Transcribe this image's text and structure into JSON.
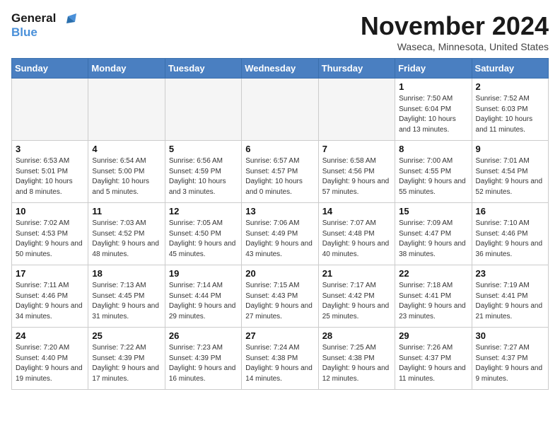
{
  "header": {
    "logo_line1": "General",
    "logo_line2": "Blue",
    "month": "November 2024",
    "location": "Waseca, Minnesota, United States"
  },
  "weekdays": [
    "Sunday",
    "Monday",
    "Tuesday",
    "Wednesday",
    "Thursday",
    "Friday",
    "Saturday"
  ],
  "weeks": [
    [
      {
        "day": "",
        "sunrise": "",
        "sunset": "",
        "daylight": ""
      },
      {
        "day": "",
        "sunrise": "",
        "sunset": "",
        "daylight": ""
      },
      {
        "day": "",
        "sunrise": "",
        "sunset": "",
        "daylight": ""
      },
      {
        "day": "",
        "sunrise": "",
        "sunset": "",
        "daylight": ""
      },
      {
        "day": "",
        "sunrise": "",
        "sunset": "",
        "daylight": ""
      },
      {
        "day": "1",
        "sunrise": "Sunrise: 7:50 AM",
        "sunset": "Sunset: 6:04 PM",
        "daylight": "Daylight: 10 hours and 13 minutes."
      },
      {
        "day": "2",
        "sunrise": "Sunrise: 7:52 AM",
        "sunset": "Sunset: 6:03 PM",
        "daylight": "Daylight: 10 hours and 11 minutes."
      }
    ],
    [
      {
        "day": "3",
        "sunrise": "Sunrise: 6:53 AM",
        "sunset": "Sunset: 5:01 PM",
        "daylight": "Daylight: 10 hours and 8 minutes."
      },
      {
        "day": "4",
        "sunrise": "Sunrise: 6:54 AM",
        "sunset": "Sunset: 5:00 PM",
        "daylight": "Daylight: 10 hours and 5 minutes."
      },
      {
        "day": "5",
        "sunrise": "Sunrise: 6:56 AM",
        "sunset": "Sunset: 4:59 PM",
        "daylight": "Daylight: 10 hours and 3 minutes."
      },
      {
        "day": "6",
        "sunrise": "Sunrise: 6:57 AM",
        "sunset": "Sunset: 4:57 PM",
        "daylight": "Daylight: 10 hours and 0 minutes."
      },
      {
        "day": "7",
        "sunrise": "Sunrise: 6:58 AM",
        "sunset": "Sunset: 4:56 PM",
        "daylight": "Daylight: 9 hours and 57 minutes."
      },
      {
        "day": "8",
        "sunrise": "Sunrise: 7:00 AM",
        "sunset": "Sunset: 4:55 PM",
        "daylight": "Daylight: 9 hours and 55 minutes."
      },
      {
        "day": "9",
        "sunrise": "Sunrise: 7:01 AM",
        "sunset": "Sunset: 4:54 PM",
        "daylight": "Daylight: 9 hours and 52 minutes."
      }
    ],
    [
      {
        "day": "10",
        "sunrise": "Sunrise: 7:02 AM",
        "sunset": "Sunset: 4:53 PM",
        "daylight": "Daylight: 9 hours and 50 minutes."
      },
      {
        "day": "11",
        "sunrise": "Sunrise: 7:03 AM",
        "sunset": "Sunset: 4:52 PM",
        "daylight": "Daylight: 9 hours and 48 minutes."
      },
      {
        "day": "12",
        "sunrise": "Sunrise: 7:05 AM",
        "sunset": "Sunset: 4:50 PM",
        "daylight": "Daylight: 9 hours and 45 minutes."
      },
      {
        "day": "13",
        "sunrise": "Sunrise: 7:06 AM",
        "sunset": "Sunset: 4:49 PM",
        "daylight": "Daylight: 9 hours and 43 minutes."
      },
      {
        "day": "14",
        "sunrise": "Sunrise: 7:07 AM",
        "sunset": "Sunset: 4:48 PM",
        "daylight": "Daylight: 9 hours and 40 minutes."
      },
      {
        "day": "15",
        "sunrise": "Sunrise: 7:09 AM",
        "sunset": "Sunset: 4:47 PM",
        "daylight": "Daylight: 9 hours and 38 minutes."
      },
      {
        "day": "16",
        "sunrise": "Sunrise: 7:10 AM",
        "sunset": "Sunset: 4:46 PM",
        "daylight": "Daylight: 9 hours and 36 minutes."
      }
    ],
    [
      {
        "day": "17",
        "sunrise": "Sunrise: 7:11 AM",
        "sunset": "Sunset: 4:46 PM",
        "daylight": "Daylight: 9 hours and 34 minutes."
      },
      {
        "day": "18",
        "sunrise": "Sunrise: 7:13 AM",
        "sunset": "Sunset: 4:45 PM",
        "daylight": "Daylight: 9 hours and 31 minutes."
      },
      {
        "day": "19",
        "sunrise": "Sunrise: 7:14 AM",
        "sunset": "Sunset: 4:44 PM",
        "daylight": "Daylight: 9 hours and 29 minutes."
      },
      {
        "day": "20",
        "sunrise": "Sunrise: 7:15 AM",
        "sunset": "Sunset: 4:43 PM",
        "daylight": "Daylight: 9 hours and 27 minutes."
      },
      {
        "day": "21",
        "sunrise": "Sunrise: 7:17 AM",
        "sunset": "Sunset: 4:42 PM",
        "daylight": "Daylight: 9 hours and 25 minutes."
      },
      {
        "day": "22",
        "sunrise": "Sunrise: 7:18 AM",
        "sunset": "Sunset: 4:41 PM",
        "daylight": "Daylight: 9 hours and 23 minutes."
      },
      {
        "day": "23",
        "sunrise": "Sunrise: 7:19 AM",
        "sunset": "Sunset: 4:41 PM",
        "daylight": "Daylight: 9 hours and 21 minutes."
      }
    ],
    [
      {
        "day": "24",
        "sunrise": "Sunrise: 7:20 AM",
        "sunset": "Sunset: 4:40 PM",
        "daylight": "Daylight: 9 hours and 19 minutes."
      },
      {
        "day": "25",
        "sunrise": "Sunrise: 7:22 AM",
        "sunset": "Sunset: 4:39 PM",
        "daylight": "Daylight: 9 hours and 17 minutes."
      },
      {
        "day": "26",
        "sunrise": "Sunrise: 7:23 AM",
        "sunset": "Sunset: 4:39 PM",
        "daylight": "Daylight: 9 hours and 16 minutes."
      },
      {
        "day": "27",
        "sunrise": "Sunrise: 7:24 AM",
        "sunset": "Sunset: 4:38 PM",
        "daylight": "Daylight: 9 hours and 14 minutes."
      },
      {
        "day": "28",
        "sunrise": "Sunrise: 7:25 AM",
        "sunset": "Sunset: 4:38 PM",
        "daylight": "Daylight: 9 hours and 12 minutes."
      },
      {
        "day": "29",
        "sunrise": "Sunrise: 7:26 AM",
        "sunset": "Sunset: 4:37 PM",
        "daylight": "Daylight: 9 hours and 11 minutes."
      },
      {
        "day": "30",
        "sunrise": "Sunrise: 7:27 AM",
        "sunset": "Sunset: 4:37 PM",
        "daylight": "Daylight: 9 hours and 9 minutes."
      }
    ]
  ]
}
